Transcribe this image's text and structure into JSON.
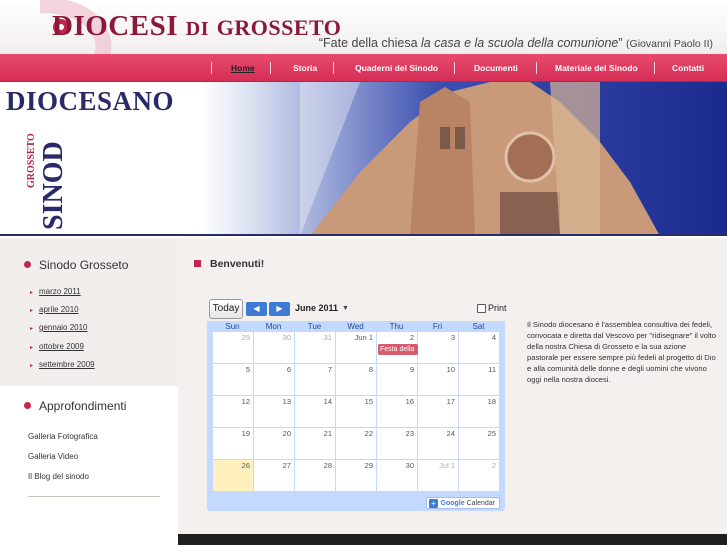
{
  "header": {
    "logo_main": "DIOCESI",
    "logo_di": "DI",
    "logo_city": "GROSSETO",
    "quote_start": "“Fate della chiesa ",
    "quote_italic": "la casa e la scuola della comunione",
    "quote_end": "”",
    "quote_author": "(Giovanni Paolo II)"
  },
  "nav": {
    "items": [
      {
        "label": "Home",
        "active": true
      },
      {
        "label": "Storia"
      },
      {
        "label": "Quaderni del Sinodo"
      },
      {
        "label": "Documenti"
      },
      {
        "label": "Materiale del Sinodo"
      },
      {
        "label": "Contatti"
      }
    ]
  },
  "banner": {
    "diocesano": "DIOCESANO",
    "grosseto": "GROSSETO",
    "sinodo": "SINOD"
  },
  "sidebar": {
    "section1_title": "Sinodo Grosseto",
    "archive": [
      "marzo 2011",
      "aprile 2010",
      "gennaio 2010",
      "ottobre 2009",
      "settembre 2009"
    ],
    "section2_title": "Approfondimenti",
    "links": [
      "Galleria Fotografica",
      "Galleria Video",
      "Il Blog del sinodo"
    ]
  },
  "main": {
    "welcome": "Benvenuti!",
    "intro": "Il Sinodo diocesano è l'assemblea consultiva dei fedeli, convocata e diretta dal Vescovo per \"ridisegnare\" il volto della nostra Chiesa di Grosseto e la sua azione pastorale per essere sempre più fedeli al progetto di Dio e alla comunità delle donne e degli uomini che vivono oggi nella nostra diocesi."
  },
  "calendar": {
    "today_label": "Today",
    "prev_icon": "left-arrow-icon",
    "next_icon": "right-arrow-icon",
    "month": "June 2011",
    "print_label": "Print",
    "days": [
      "Sun",
      "Mon",
      "Tue",
      "Wed",
      "Thu",
      "Fri",
      "Sat"
    ],
    "weeks": [
      [
        "29",
        "30",
        "31",
        "Jun 1",
        "2",
        "3",
        "4"
      ],
      [
        "5",
        "6",
        "7",
        "8",
        "9",
        "10",
        "11"
      ],
      [
        "12",
        "13",
        "14",
        "15",
        "16",
        "17",
        "18"
      ],
      [
        "19",
        "20",
        "21",
        "22",
        "23",
        "24",
        "25"
      ],
      [
        "26",
        "27",
        "28",
        "29",
        "30",
        "Jul 1",
        "2"
      ]
    ],
    "event": "Festa della",
    "google_word": "Google",
    "calendar_word": "Calendar",
    "event_color": "#d65c6b",
    "today_color": "#fff1be"
  },
  "colors": {
    "accent": "#c3274b",
    "nav": "#e03a60",
    "brand_dark": "#2a2a6a"
  }
}
